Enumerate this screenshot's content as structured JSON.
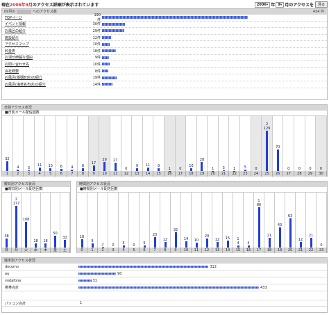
{
  "header": {
    "prefix": "現在",
    "month_text": "2006年9月",
    "suffix": "のアクセス詳細が表示されています",
    "year": "2006",
    "year_unit": "年",
    "month": "9",
    "month_unit": "月のアクセスを",
    "button": "見る"
  },
  "summary": {
    "title": "09月の",
    "title_suffix": "へのアクセス数",
    "total": "434 件",
    "rows": [
      {
        "label": "TOPページ",
        "count": "190件",
        "value": 190
      },
      {
        "label": "イベント情報",
        "count": "30件",
        "value": 30
      },
      {
        "label": "お風呂の紹介",
        "count": "29件",
        "value": 29
      },
      {
        "label": "施設紹介",
        "count": "12件",
        "value": 12
      },
      {
        "label": "アクセスマップ",
        "count": "10件",
        "value": 10
      },
      {
        "label": "料金表",
        "count": "18件",
        "value": 18
      },
      {
        "label": "お湯が綺麗な理由",
        "count": "9件",
        "value": 9
      },
      {
        "label": "お問い合わせ先",
        "count": "10件",
        "value": 10
      },
      {
        "label": "会社概要",
        "count": "8件",
        "value": 8
      },
      {
        "label": "お風呂(婚姻町店)の紹介",
        "count": "19件",
        "value": 19
      },
      {
        "label": "お風呂(海老名市店)の紹介",
        "count": "14件",
        "value": 14
      }
    ]
  },
  "daily": {
    "title": "日別アクセス状況",
    "sub": "■日別メール配信回数",
    "labels": [
      "1",
      "2",
      "3",
      "4",
      "5",
      "6",
      "7",
      "8",
      "9",
      "10",
      "11",
      "12",
      "13",
      "14",
      "15",
      "16",
      "17",
      "18",
      "19",
      "20",
      "21",
      "22",
      "23",
      "24",
      "25",
      "26",
      "27",
      "28",
      "29",
      "30"
    ],
    "values": [
      32,
      4,
      3,
      11,
      10,
      6,
      4,
      8,
      17,
      29,
      27,
      0,
      9,
      11,
      9,
      1,
      0,
      10,
      28,
      1,
      3,
      1,
      5,
      0,
      129,
      70,
      0,
      0,
      0,
      0
    ],
    "mail": [
      "",
      "",
      "",
      "",
      "",
      "",
      "",
      "",
      "",
      "",
      "",
      "",
      "",
      "",
      "",
      "",
      "",
      "",
      "",
      "",
      "",
      "",
      "",
      "",
      "2",
      "",
      "",
      "",
      "",
      ""
    ],
    "grey": [
      false,
      false,
      false,
      false,
      false,
      false,
      false,
      false,
      true,
      true,
      false,
      false,
      false,
      false,
      false,
      true,
      true,
      false,
      false,
      false,
      false,
      false,
      false,
      true,
      true,
      false,
      false,
      false,
      false,
      true
    ]
  },
  "weekday": {
    "title": "曜日別アクセス状況",
    "sub": "■曜日別メール配信回数",
    "labels": [
      "日",
      "月",
      "火",
      "水",
      "木",
      "金",
      "土"
    ],
    "values": [
      38,
      177,
      108,
      18,
      18,
      50,
      32
    ],
    "mail": [
      "",
      "2",
      "",
      "",
      "",
      "",
      ""
    ]
  },
  "hourly": {
    "title": "時間別アクセス状況",
    "sub": "■時間別メール配信回数",
    "labels": [
      "0",
      "1",
      "2",
      "3",
      "4",
      "5",
      "6",
      "7",
      "8",
      "9",
      "10",
      "11",
      "12",
      "13",
      "14",
      "15",
      "16",
      "17",
      "18",
      "19",
      "20",
      "21",
      "22",
      "23"
    ],
    "values": [
      18,
      9,
      2,
      0,
      5,
      0,
      5,
      23,
      12,
      32,
      14,
      10,
      20,
      12,
      15,
      4,
      4,
      86,
      21,
      43,
      63,
      12,
      21,
      0
    ],
    "mail": [
      "",
      "",
      "",
      "",
      "",
      "",
      "",
      "",
      "",
      "",
      "",
      "",
      "",
      "",
      "",
      "1",
      "",
      "1",
      "",
      "",
      "",
      "",
      "",
      ""
    ]
  },
  "carrier": {
    "title": "端末別アクセス状況",
    "rows": [
      {
        "label": "docomo",
        "value": 312,
        "count": "312"
      },
      {
        "label": "au",
        "value": 90,
        "count": "90"
      },
      {
        "label": "vodafone",
        "value": 31,
        "count": "31"
      },
      {
        "label": "携帯合計",
        "value": 433,
        "count": "433"
      }
    ],
    "pc_label": "パソコン合計",
    "pc_value": "1"
  }
}
